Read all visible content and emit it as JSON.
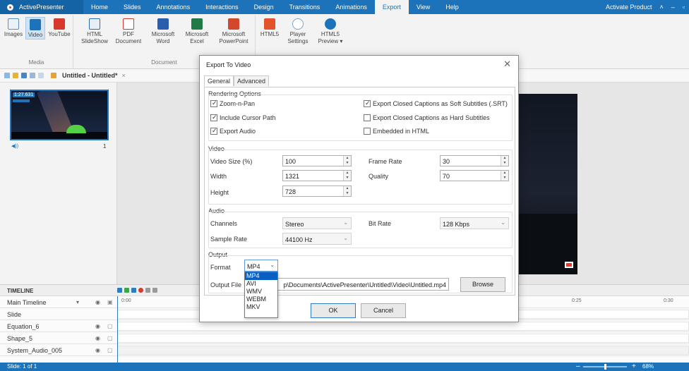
{
  "app": {
    "name": "ActivePresenter"
  },
  "menu": {
    "items": [
      "Home",
      "Slides",
      "Annotations",
      "Interactions",
      "Design",
      "Transitions",
      "Animations",
      "Export",
      "View",
      "Help"
    ],
    "active": "Export",
    "activate_product": "Activate Product"
  },
  "ribbon": {
    "media": {
      "images": "Images",
      "video": "Video",
      "youtube": "YouTube",
      "group_label": "Media"
    },
    "document": {
      "html_line1": "HTML",
      "html_line2": "SlideShow",
      "pdf_line1": "PDF",
      "pdf_line2": "Document",
      "word_line1": "Microsoft",
      "word_line2": "Word",
      "excel_line1": "Microsoft",
      "excel_line2": "Excel",
      "ppt_line1": "Microsoft",
      "ppt_line2": "PowerPoint",
      "group_label": "Document"
    },
    "html5": {
      "html5": "HTML5",
      "player_line1": "Player",
      "player_line2": "Settings",
      "preview_line1": "HTML5",
      "preview_line2": "Preview ▾"
    }
  },
  "document_tab": {
    "title": "Untitled - Untitled*",
    "close": "×"
  },
  "slide_panel": {
    "thumb_duration": "1:27.631",
    "thumb_audio": "◀))",
    "thumb_number": "1"
  },
  "timeline": {
    "title": "TIMELINE",
    "ruler": [
      "0:00",
      "0:25",
      "0:30"
    ],
    "rows": [
      {
        "label": "Main Timeline"
      },
      {
        "label": "Slide"
      },
      {
        "label": "Equation_6"
      },
      {
        "label": "Shape_5"
      },
      {
        "label": "System_Audio_005"
      }
    ]
  },
  "status": {
    "slide": "Slide: 1 of 1",
    "zoom": "68%"
  },
  "dialog": {
    "title": "Export To Video",
    "tabs": [
      "General",
      "Advanced"
    ],
    "rendering": {
      "label": "Rendering Options",
      "zoom_n_pan": "Zoom-n-Pan",
      "include_cursor": "Include Cursor Path",
      "export_audio": "Export Audio",
      "cc_soft": "Export Closed Captions as Soft Subtitles (.SRT)",
      "cc_hard": "Export Closed Captions as Hard Subtitles",
      "embedded_html": "Embedded in HTML"
    },
    "video": {
      "label": "Video",
      "size_label": "Video Size (%)",
      "size_value": "100",
      "width_label": "Width",
      "width_value": "1321",
      "height_label": "Height",
      "height_value": "728",
      "frame_rate_label": "Frame Rate",
      "frame_rate_value": "30",
      "quality_label": "Quality",
      "quality_value": "70"
    },
    "audio": {
      "label": "Audio",
      "channels_label": "Channels",
      "channels_value": "Stereo",
      "sample_rate_label": "Sample Rate",
      "sample_rate_value": "44100 Hz",
      "bit_rate_label": "Bit Rate",
      "bit_rate_value": "128 Kbps"
    },
    "output": {
      "label": "Output",
      "format_label": "Format",
      "format_value": "MP4",
      "format_options": [
        "MP4",
        "AVI",
        "WMV",
        "WEBM",
        "MKV"
      ],
      "file_label": "Output File",
      "file_value": "p\\Documents\\ActivePresenter\\Untitled\\Video\\Untitled.mp4",
      "browse": "Browse"
    },
    "ok": "OK",
    "cancel": "Cancel"
  }
}
